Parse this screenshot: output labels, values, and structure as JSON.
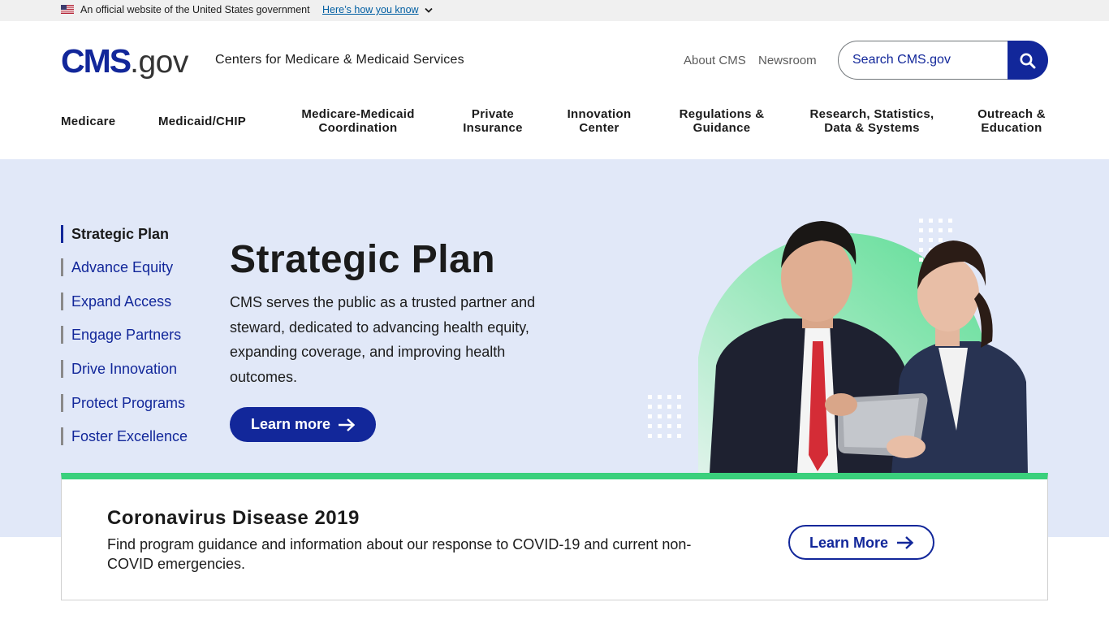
{
  "gov_banner": {
    "text": "An official website of the United States government",
    "link": "Here’s how you know"
  },
  "header": {
    "logo_main": "CMS",
    "logo_suffix": ".gov",
    "agency": "Centers for Medicare & Medicaid Services",
    "util_links": [
      "About CMS",
      "Newsroom"
    ],
    "search_placeholder": "Search CMS.gov"
  },
  "nav": [
    {
      "line1": "Medicare",
      "line2": ""
    },
    {
      "line1": "Medicaid/CHIP",
      "line2": ""
    },
    {
      "line1": "Medicare-Medicaid",
      "line2": "Coordination"
    },
    {
      "line1": "Private",
      "line2": "Insurance"
    },
    {
      "line1": "Innovation",
      "line2": "Center"
    },
    {
      "line1": "Regulations &",
      "line2": "Guidance"
    },
    {
      "line1": "Research, Statistics,",
      "line2": "Data & Systems"
    },
    {
      "line1": "Outreach &",
      "line2": "Education"
    }
  ],
  "hero": {
    "side_links": [
      "Strategic Plan",
      "Advance Equity",
      "Expand Access",
      "Engage Partners",
      "Drive Innovation",
      "Protect Programs",
      "Foster Excellence"
    ],
    "title": "Strategic Plan",
    "description": "CMS serves the public as a trusted partner and steward, dedicated to advancing health equity, expanding coverage, and improving health outcomes.",
    "button": "Learn more"
  },
  "covid_card": {
    "title": "Coronavirus Disease 2019",
    "description": "Find program guidance and information about our response to COVID-19 and current non-COVID emergencies.",
    "button": "Learn More"
  },
  "colors": {
    "brand_blue": "#12279a",
    "hero_bg": "#e1e8f8",
    "accent_green": "#3ad07c"
  },
  "icons": [
    "us-flag-icon",
    "chevron-down-icon",
    "search-icon",
    "arrow-right-icon"
  ]
}
